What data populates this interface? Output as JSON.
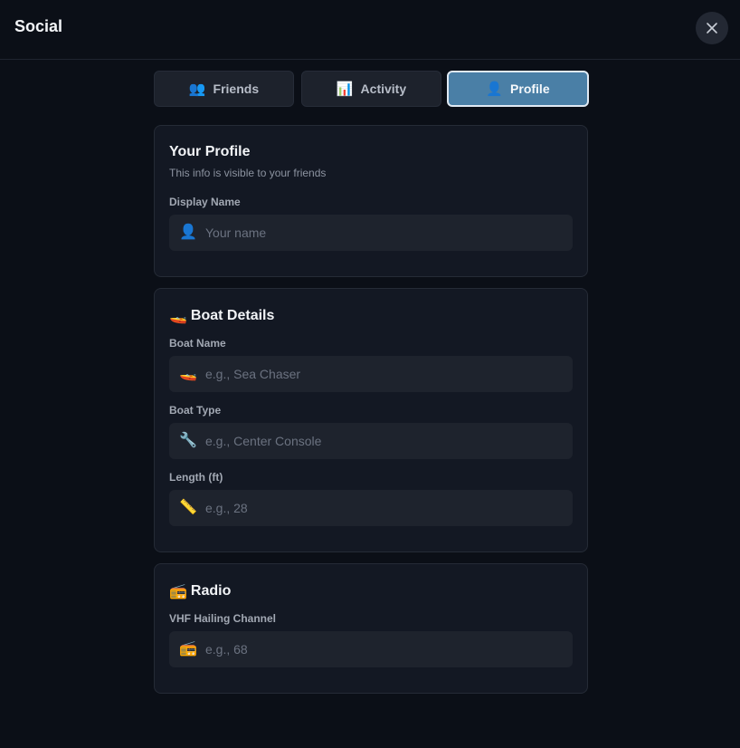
{
  "header": {
    "title": "Social",
    "close_icon": "close-icon"
  },
  "tabs": [
    {
      "icon": "👥",
      "label": "Friends",
      "active": false
    },
    {
      "icon": "📊",
      "label": "Activity",
      "active": false
    },
    {
      "icon": "👤",
      "label": "Profile",
      "active": true
    }
  ],
  "profile": {
    "title": "Your Profile",
    "subtitle": "This info is visible to your friends",
    "display_name": {
      "label": "Display Name",
      "icon": "👤",
      "placeholder": "Your name",
      "value": ""
    }
  },
  "boat": {
    "icon": "🚤",
    "title": "Boat Details",
    "name": {
      "label": "Boat Name",
      "icon": "🚤",
      "placeholder": "e.g., Sea Chaser",
      "value": ""
    },
    "type": {
      "label": "Boat Type",
      "icon": "🔧",
      "placeholder": "e.g., Center Console",
      "value": ""
    },
    "length": {
      "label": "Length (ft)",
      "icon": "📏",
      "placeholder": "e.g., 28",
      "value": ""
    }
  },
  "radio": {
    "icon": "📻",
    "title": "Radio",
    "channel": {
      "label": "VHF Hailing Channel",
      "icon": "📻",
      "placeholder": "e.g., 68",
      "value": ""
    }
  },
  "colors": {
    "accent": "#4a7fa6",
    "background": "#0b0f17",
    "card": "#131823"
  }
}
